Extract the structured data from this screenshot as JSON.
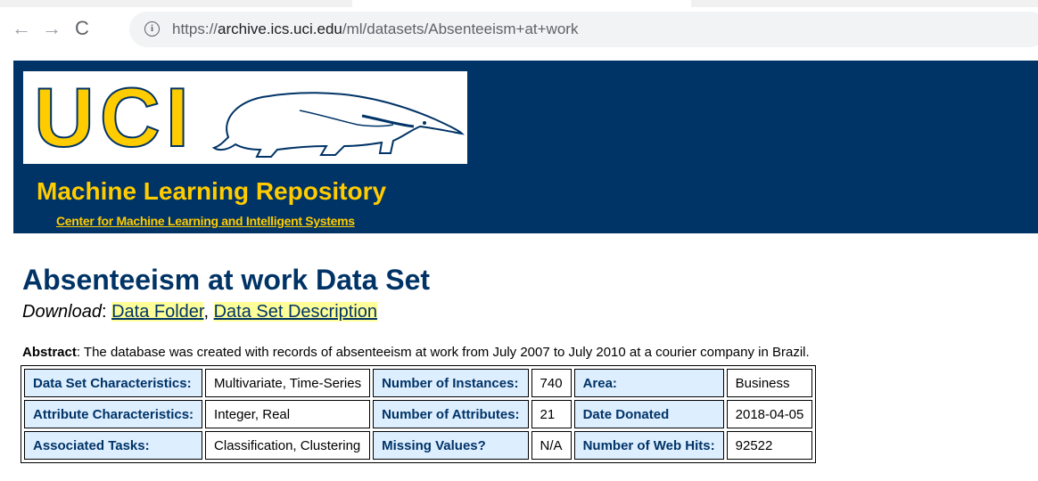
{
  "browser": {
    "back_icon": "←",
    "forward_icon": "→",
    "reload_icon": "C",
    "info_icon": "i",
    "url_scheme": "https://",
    "url_host": "archive.ics.uci.edu",
    "url_path": "/ml/datasets/Absenteeism+at+work"
  },
  "header": {
    "logo_text": "UCI",
    "repo_title": "Machine Learning Repository",
    "center_link": "Center for Machine Learning and Intelligent Systems",
    "brand_color": "#003366",
    "accent_color": "#ffcc00"
  },
  "dataset": {
    "title": "Absenteeism at work Data Set",
    "download_label": "Download",
    "download_sep": ": ",
    "link_data_folder": "Data Folder",
    "link_comma": ", ",
    "link_description": "Data Set Description",
    "abstract_label": "Abstract",
    "abstract_text": ": The database was created with records of absenteeism at work from July 2007 to July 2010 at a courier company in Brazil."
  },
  "table": {
    "rows": [
      [
        {
          "label": "Data Set Characteristics:",
          "value": "Multivariate, Time-Series"
        },
        {
          "label": "Number of Instances:",
          "value": "740"
        },
        {
          "label": "Area:",
          "value": "Business"
        }
      ],
      [
        {
          "label": "Attribute Characteristics:",
          "value": "Integer, Real"
        },
        {
          "label": "Number of Attributes:",
          "value": "21"
        },
        {
          "label": "Date Donated",
          "value": "2018-04-05"
        }
      ],
      [
        {
          "label": "Associated Tasks:",
          "value": "Classification, Clustering"
        },
        {
          "label": "Missing Values?",
          "value": "N/A"
        },
        {
          "label": "Number of Web Hits:",
          "value": "92522"
        }
      ]
    ]
  }
}
